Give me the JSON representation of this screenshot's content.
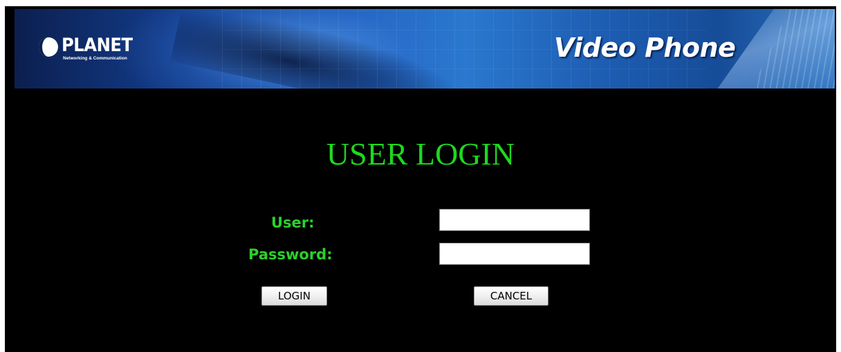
{
  "header": {
    "brand_name": "PLANET",
    "brand_tagline": "Networking & Communication",
    "product_title": "Video Phone",
    "logo_icon": "planet-logo-icon"
  },
  "login": {
    "title": "USER LOGIN",
    "user_label": "User:",
    "user_value": "",
    "password_label": "Password:",
    "password_value": "",
    "login_button": "LOGIN",
    "cancel_button": "CANCEL"
  },
  "colors": {
    "background": "#000000",
    "accent_green": "#1fd81f",
    "banner_blue": "#1b5cb8"
  }
}
